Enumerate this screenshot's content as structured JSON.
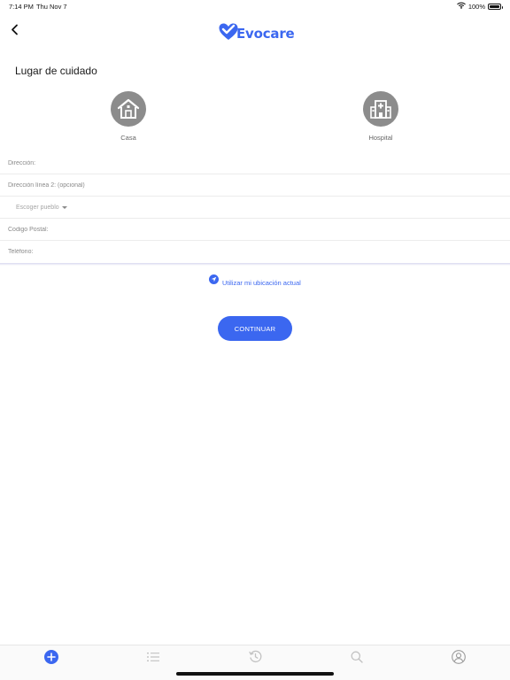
{
  "status_bar": {
    "time": "7:14 PM",
    "date": "Thu Nov 7",
    "battery": "100%",
    "battery_level": 1.0
  },
  "header": {
    "logo_text": "Evocare",
    "back_icon": "chevron-left-icon"
  },
  "page": {
    "title": "Lugar de cuidado"
  },
  "place_options": [
    {
      "label": "Casa",
      "icon": "house-icon"
    },
    {
      "label": "Hospital",
      "icon": "hospital-icon"
    }
  ],
  "form": {
    "address_placeholder": "Dirección:",
    "address2_placeholder": "Dirección línea 2: (opcional)",
    "town_select_label": "Escoger pueblo",
    "postal_placeholder": "Codigo Postal:",
    "phone_placeholder": "Teléfono:"
  },
  "location": {
    "label": "Utilizar mi ubicación actual",
    "icon": "navigation-arrow-icon"
  },
  "actions": {
    "continue_label": "CONTINUAR"
  },
  "tab_bar": {
    "items": [
      {
        "icon": "plus-circle-icon",
        "active": true
      },
      {
        "icon": "list-icon",
        "active": false
      },
      {
        "icon": "history-icon",
        "active": false
      },
      {
        "icon": "search-icon",
        "active": false
      },
      {
        "icon": "user-profile-icon",
        "active": false
      }
    ]
  },
  "colors": {
    "accent": "#3b67f0",
    "icon_gray": "#8c8c8c",
    "inactive_tab": "#c2c2c2"
  }
}
